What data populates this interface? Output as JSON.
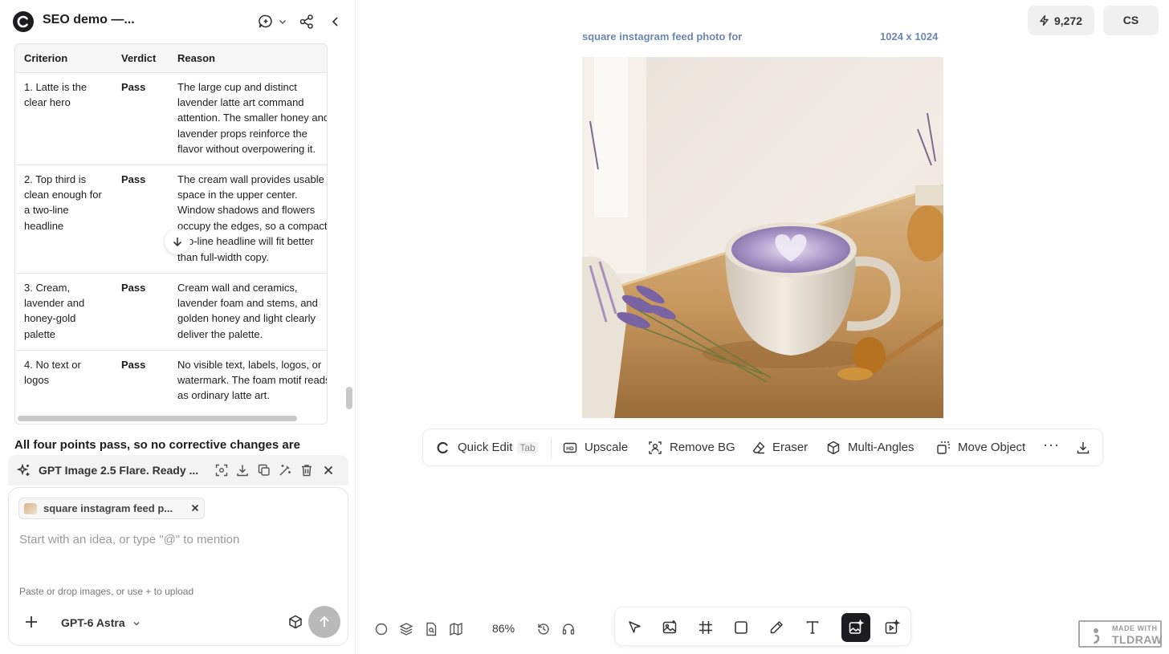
{
  "header": {
    "project_title": "SEO demo —..."
  },
  "table": {
    "columns": [
      "Criterion",
      "Verdict",
      "Reason"
    ],
    "rows": [
      {
        "criterion": "1. Latte is the clear hero",
        "verdict": "Pass",
        "reason": "The large cup and distinct lavender latte art command attention. The smaller honey and lavender props reinforce the flavor without overpowering it."
      },
      {
        "criterion": "2. Top third is clean enough for a two-line headline",
        "verdict": "Pass",
        "reason": "The cream wall provides usable space in the upper center. Window shadows and flowers occupy the edges, so a compact two-line headline will fit better than full-width copy."
      },
      {
        "criterion": "3. Cream, lavender and honey-gold palette",
        "verdict": "Pass",
        "reason": "Cream wall and ceramics, lavender foam and stems, and golden honey and light clearly deliver the palette."
      },
      {
        "criterion": "4. No text or logos",
        "verdict": "Pass",
        "reason": "No visible text, labels, logos, or watermark. The foam motif reads as ordinary latte art."
      }
    ]
  },
  "summary_text": "All four points pass, so no corrective changes are",
  "generation": {
    "label": "GPT Image 2.5 Flare. Ready ..."
  },
  "composer": {
    "chip_label": "square instagram feed p...",
    "placeholder": "Start with an idea, or type \"@\" to mention",
    "hint": "Paste or drop images, or use + to upload",
    "model": "GPT-6 Astra"
  },
  "topbar": {
    "credits": "9,272",
    "avatar": "CS"
  },
  "image": {
    "title": "square instagram feed photo for",
    "dimensions": "1024 x 1024"
  },
  "image_toolbar": {
    "quick_edit": "Quick Edit",
    "tab_key": "Tab",
    "upscale": "Upscale",
    "remove_bg": "Remove BG",
    "eraser": "Eraser",
    "multi_angles": "Multi-Angles",
    "move_object": "Move Object",
    "more": "···"
  },
  "canvas": {
    "zoom": "86%"
  },
  "branding": {
    "line1": "MADE WITH",
    "line2": "TLDRAW"
  },
  "colors": {
    "accent_link": "#6b86b3",
    "active_tool": "#1d1d1f",
    "send_disabled": "#b9b9b9"
  }
}
